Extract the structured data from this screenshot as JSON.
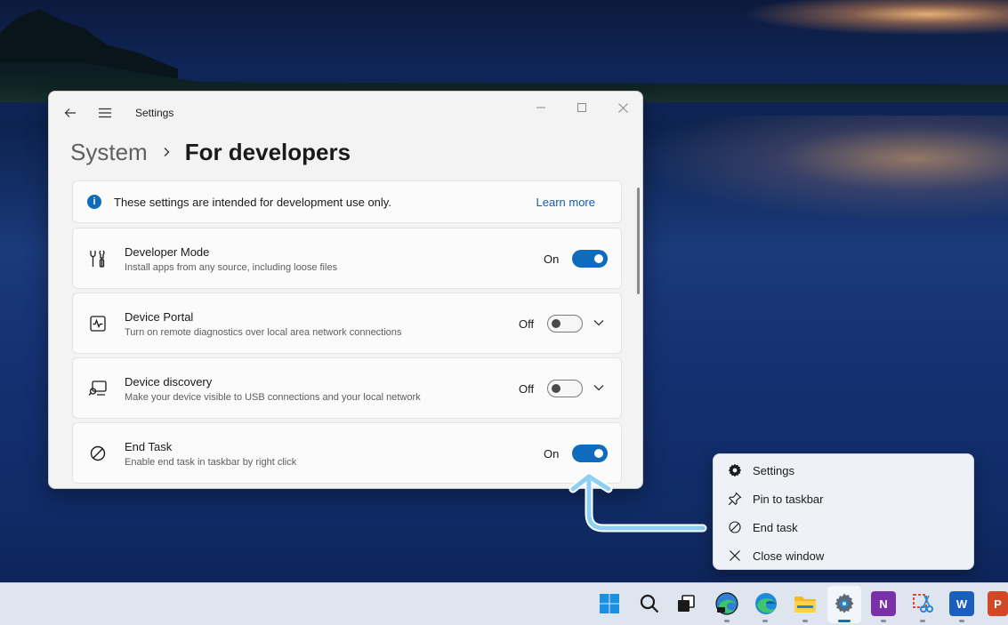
{
  "window": {
    "app_title": "Settings",
    "breadcrumb_parent": "System",
    "breadcrumb_current": "For developers"
  },
  "infobar": {
    "text": "These settings are intended for development use only.",
    "link": "Learn more"
  },
  "settings": [
    {
      "title": "Developer Mode",
      "subtitle": "Install apps from any source, including loose files",
      "state": "On",
      "icon": "developer-tools-icon",
      "expandable": false
    },
    {
      "title": "Device Portal",
      "subtitle": "Turn on remote diagnostics over local area network connections",
      "state": "Off",
      "icon": "pulse-icon",
      "expandable": true
    },
    {
      "title": "Device discovery",
      "subtitle": "Make your device visible to USB connections and your local network",
      "state": "Off",
      "icon": "device-search-icon",
      "expandable": true
    },
    {
      "title": "End Task",
      "subtitle": "Enable end task in taskbar by right click",
      "state": "On",
      "icon": "end-task-icon",
      "expandable": false
    }
  ],
  "context_menu": {
    "items": [
      {
        "label": "Settings",
        "icon": "gear-icon"
      },
      {
        "label": "Pin to taskbar",
        "icon": "pin-icon"
      },
      {
        "label": "End task",
        "icon": "end-task-icon"
      },
      {
        "label": "Close window",
        "icon": "close-icon"
      }
    ]
  },
  "taskbar": {
    "apps": [
      "start",
      "search",
      "task-view",
      "edge-beta",
      "edge",
      "file-explorer",
      "settings",
      "onenote",
      "snipping-tool",
      "word",
      "powerpoint"
    ],
    "onenote_letter": "N",
    "word_letter": "W",
    "powerpoint_letter": "P"
  },
  "colors": {
    "accent": "#0f6cbd",
    "arrow": "#8ed0f5"
  }
}
